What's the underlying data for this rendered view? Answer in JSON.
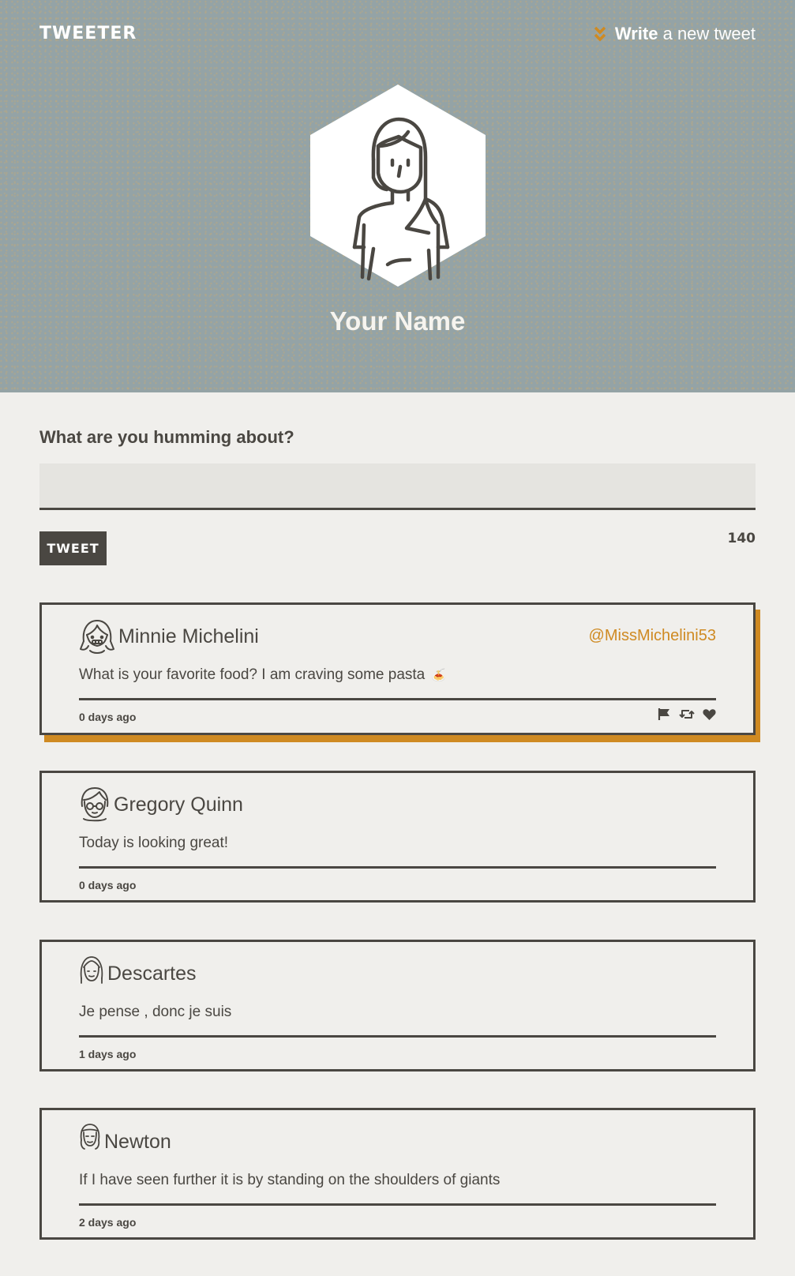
{
  "header": {
    "brand": "TWEETER",
    "write_link": {
      "bold": "Write",
      "rest": "a new tweet"
    },
    "profile_name": "Your Name"
  },
  "composer": {
    "label": "What are you humming about?",
    "value": "",
    "placeholder": "",
    "button_label": "TWEET",
    "char_count": "140"
  },
  "tweets": [
    {
      "author": "Minnie Michelini",
      "handle": "@MissMichelini53",
      "text": "What is your favorite food? I am craving some pasta",
      "emoji": "🍝",
      "time": "0 days ago",
      "actions": [
        "flag-icon",
        "retweet-icon",
        "heart-icon"
      ]
    },
    {
      "author": "Gregory Quinn",
      "text": "Today is looking great!",
      "time": "0 days ago"
    },
    {
      "author": "Descartes",
      "text": "Je pense , donc je suis",
      "time": "1 days ago"
    },
    {
      "author": "Newton",
      "text": "If I have seen further it is by standing on the shoulders of giants",
      "time": "2 days ago"
    }
  ],
  "colors": {
    "header_bg": "#94a3a6",
    "page_bg": "#f0efec",
    "ink": "#4a4742",
    "accent": "#cf8a22"
  }
}
